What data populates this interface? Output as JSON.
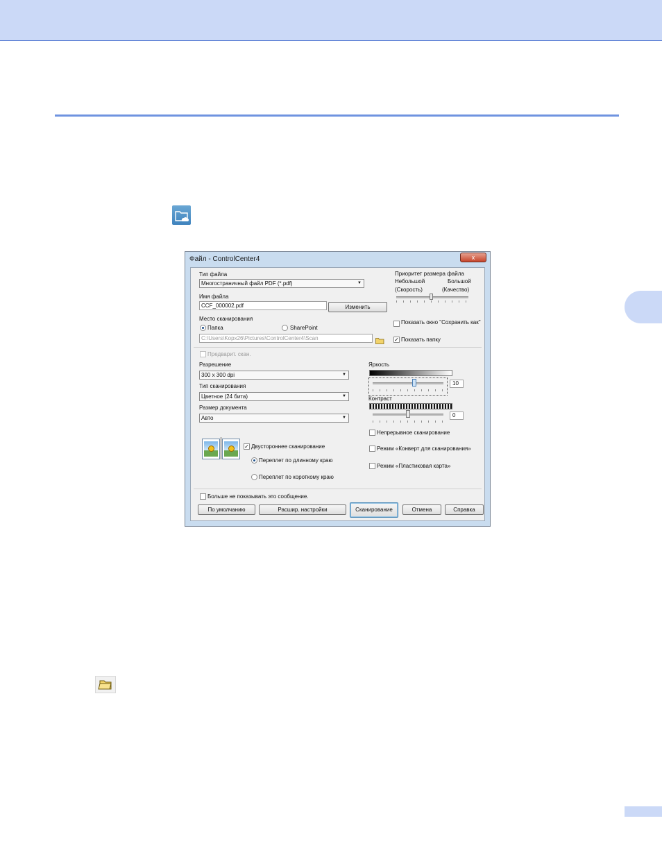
{
  "dialog": {
    "title": "Файл - ControlCenter4",
    "close_glyph": "x",
    "file_type": {
      "label": "Тип файла",
      "value": "Многостраничный файл PDF (*.pdf)"
    },
    "file_name": {
      "label": "Имя файла",
      "value": "CCF_000002.pdf",
      "change_button": "Изменить"
    },
    "scan_location": {
      "label": "Место сканирования",
      "folder_option": "Папка",
      "sharepoint_option": "SharePoint",
      "path_value": "C:\\Users\\Kopx26\\Pictures\\ControlCenter4\\Scan"
    },
    "size_priority": {
      "title": "Приоритет размера файла",
      "small": "Небольшой",
      "speed": "(Скорость)",
      "large": "Большой",
      "quality": "(Качество)"
    },
    "show_save_as_window": "Показать окно \"Сохранить как\"",
    "show_folder": "Показать папку",
    "prescan": "Предварит. скан.",
    "resolution": {
      "label": "Разрешение",
      "value": "300 x 300  dpi"
    },
    "scan_type": {
      "label": "Тип сканирования",
      "value": "Цветное (24 бита)"
    },
    "document_size": {
      "label": "Размер документа",
      "value": "Авто"
    },
    "brightness": {
      "label": "Яркость",
      "value": "10"
    },
    "contrast": {
      "label": "Контраст",
      "value": "0"
    },
    "continuous_scan": "Непрерывное сканирование",
    "carrier_sheet_mode": "Режим «Конверт для сканирования»",
    "plastic_card_mode": "Режим «Пластиковая карта»",
    "duplex": {
      "label": "Двустороннее сканирование",
      "long_edge": "Переплет по длинному краю",
      "short_edge": "Переплет по короткому краю"
    },
    "dont_show_again": "Больше не показывать это сообщение.",
    "buttons": {
      "default": "По умолчанию",
      "advanced": "Расшир. настройки",
      "scan": "Сканирование",
      "cancel": "Отмена",
      "help": "Справка"
    }
  },
  "icons": {
    "cloud_folder": "scan-to-file-icon",
    "folder": "folder-icon"
  },
  "colors": {
    "header_band": "#cbd9f7",
    "rule": "#6f93e0",
    "dialog_frame": "#c9dcef"
  }
}
